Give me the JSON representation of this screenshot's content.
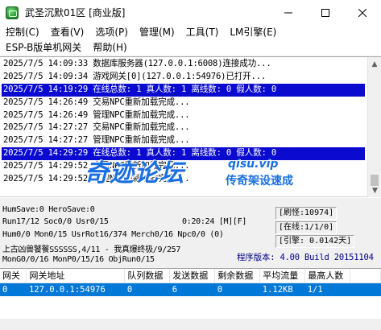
{
  "window": {
    "title": "武圣沉默01区 [商业版]"
  },
  "menu": {
    "row1": [
      "控制(C)",
      "查看(V)",
      "选项(P)",
      "管理(M)",
      "工具(T)",
      "LM引擎(E)"
    ],
    "row2": [
      "ESP-B版单机网关",
      "帮助(H)"
    ]
  },
  "log": {
    "lines": [
      {
        "text": "2025/7/5 14:09:33 数据库服务器(127.0.0.1:6008)连接成功...",
        "highlight": false
      },
      {
        "text": "2025/7/5 14:09:34 游戏网关[0](127.0.0.1:54976)已打开...",
        "highlight": false
      },
      {
        "text": "2025/7/5 14:19:29 在线总数: 1 真人数: 1 离线数: 0 假人数: 0",
        "highlight": true
      },
      {
        "text": "2025/7/5 14:26:49 交易NPC重新加载完成...",
        "highlight": false
      },
      {
        "text": "2025/7/5 14:26:49 管理NPC重新加载完成...",
        "highlight": false
      },
      {
        "text": "2025/7/5 14:27:27 交易NPC重新加载完成...",
        "highlight": false
      },
      {
        "text": "2025/7/5 14:27:27 管理NPC重新加载完成...",
        "highlight": false
      },
      {
        "text": "2025/7/5 14:29:29 在线总数: 1 真人数: 1 离线数: 0 假人数: 0",
        "highlight": true
      },
      {
        "text": "2025/7/5 14:29:52 交易NPC重新加载完成...",
        "highlight": false
      },
      {
        "text": "2025/7/5 14:29:52 管理NPC重新加载完成...",
        "highlight": false
      },
      {
        "text": "",
        "highlight": false
      }
    ]
  },
  "watermark": {
    "main": "奇迹论坛",
    "url": "qisu.vip",
    "slogan": "传奇架设速成"
  },
  "status": {
    "line1": "HumSave:0 HeroSave:0",
    "line2_left": "Run17/12 Soc0/0 Usr0/15",
    "line2_time": "0:20:24 [M][F]",
    "line3": "Hum0/0 Mon0/15 UsrRot16/374 Merch0/16 Npc0/0 (0)",
    "line4": "上古凶兽饕餮SSSSSS,4/11 - 我真爆终极/9/257",
    "line5": "MonG0/0/16 MonP0/15/16 ObjRun0/15",
    "refresh": "[刷怪:10974]",
    "online": "[在线:1/1/0]",
    "engine": "[引擎: 0.0142天]",
    "version": "程序版本: 4.00 Build 20151104"
  },
  "table": {
    "columns": [
      "网关",
      "网关地址",
      "队列数据",
      "发送数据",
      "剩余数据",
      "平均流量",
      "最高人数"
    ],
    "rows": [
      [
        "0",
        "127.0.0.1:54976",
        "0",
        "6",
        "0",
        "1.12KB",
        "1/1"
      ]
    ]
  },
  "colors": {
    "highlight_bg": "#0a0ad0",
    "selection_bg": "#0078d7",
    "version_text": "#00008b",
    "watermark": "#1a6fe0"
  },
  "icons": {
    "app": "game-server-icon",
    "minimize": "minimize-icon",
    "maximize": "maximize-icon",
    "close": "close-icon"
  }
}
